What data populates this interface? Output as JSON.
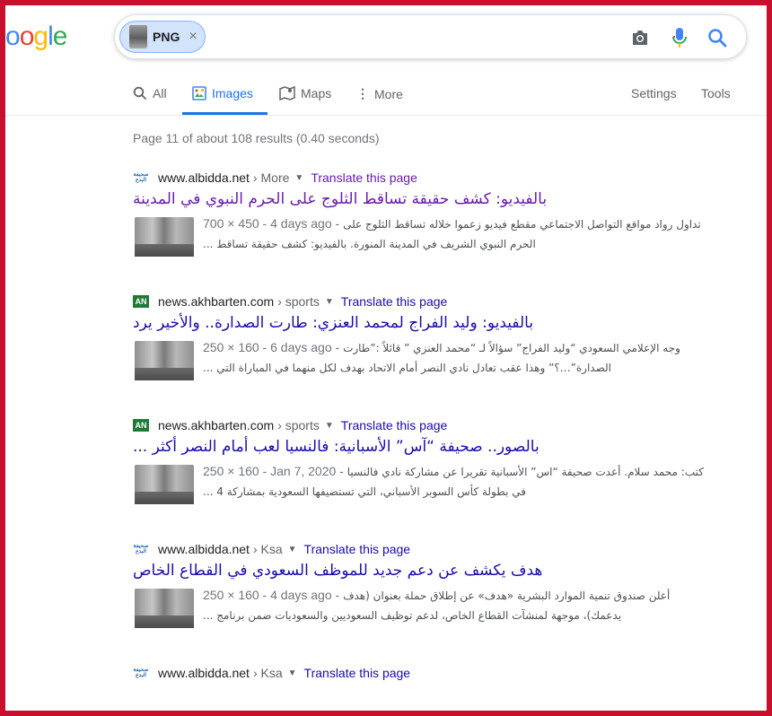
{
  "logo": {
    "text": "oogle",
    "colors": [
      "#4285f4",
      "#ea4335",
      "#fbbc05",
      "#4285f4",
      "#34a853",
      "#ea4335"
    ]
  },
  "search": {
    "chip_label": "PNG",
    "chip_close": "×"
  },
  "tabs": [
    {
      "label": "All",
      "icon": "search-icon"
    },
    {
      "label": "Images",
      "icon": "image-icon",
      "active": true
    },
    {
      "label": "Maps",
      "icon": "map-icon"
    },
    {
      "label": "More",
      "icon": "more-vert-icon"
    }
  ],
  "tools": {
    "settings": "Settings",
    "tools": "Tools"
  },
  "stats": "Page 11 of about 108 results (0.40 seconds)",
  "results": [
    {
      "domain": "www.albidda.net",
      "crumb": "› More",
      "translate": "Translate this page",
      "title": "بالفيديو: كشف حقيقة تساقط الثلوج على الحرم النبوي في المدينة",
      "meta": "700 × 450 - 4 days ago -",
      "snippet1": "تداول رواد مواقع التواصل الاجتماعي مقطع فيديو زعموا خلاله تساقط الثلوج على",
      "snippet2": "الحرم النبوي الشريف في المدينة المنورة. بالفيديو: كشف حقيقة تساقط ..."
    },
    {
      "domain": "news.akhbarten.com",
      "crumb": "› sports",
      "translate": "Translate this page",
      "title": "بالفيديو: وليد الفراج لمحمد العنزي: طارت الصدارة.. والأخير يرد",
      "meta": "250 × 160 - 6 days ago -",
      "snippet1": "وجه الإعلامي السعودي “وليد الفراج” سؤالاً لـ “محمد العنزي ” قائلاً :”طارت",
      "snippet2": "الصدارة”…؟” وهذا عقب تعادل نادي النصر أمام الاتحاد بهدف لكل منهما في المباراة التي ..."
    },
    {
      "domain": "news.akhbarten.com",
      "crumb": "› sports",
      "translate": "Translate this page",
      "title": "بالصور.. صحيفة “آس” الأسبانية: فالنسيا لعب أمام النصر أكثر ...",
      "meta": "250 × 160 - Jan 7, 2020 -",
      "snippet1": "كتب: محمد سلام. أعدت صحيفة “اس” الأسبانية تقريرا عن مشاركة نادي فالنسيا",
      "snippet2": "في بطولة كأس السوبر الأسباني، التي تستضيفها السعودية بمشاركة 4 ..."
    },
    {
      "domain": "www.albidda.net",
      "crumb": "› Ksa",
      "translate": "Translate this page",
      "title": "هدف يكشف عن دعم جديد للموظف السعودي في القطاع الخاص",
      "meta": "250 × 160 - 4 days ago -",
      "snippet1": "أعلن صندوق تنمية الموارد البشرية «هدف» عن إطلاق حملة بعنوان (هدف",
      "snippet2": "يدعمك)، موجهة لمنشآت القطاع الخاص، لدعم توظيف السعوديين والسعوديات ضمن برنامج ..."
    },
    {
      "domain": "www.albidda.net",
      "crumb": "› Ksa",
      "translate": "Translate this page"
    }
  ],
  "favicon_labels": {
    "albidda": "صحيفة البدع",
    "akhbarten": "AN"
  }
}
